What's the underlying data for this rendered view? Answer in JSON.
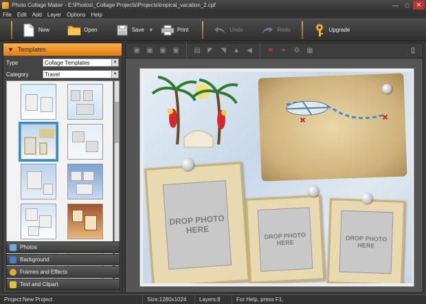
{
  "window": {
    "title": "Photo Collage Maker - E:\\Photos\\_Collage Projects\\Projects\\tropical_vacation_2.cpf"
  },
  "menu": [
    "File",
    "Edit",
    "Add",
    "Layer",
    "Options",
    "Help"
  ],
  "toolbar": {
    "new_label": "New",
    "open_label": "Open",
    "save_label": "Save",
    "print_label": "Print",
    "undo_label": "Undo",
    "redo_label": "Redo",
    "upgrade_label": "Upgrade"
  },
  "left_panel": {
    "header": "Templates",
    "type_label": "Type",
    "type_value": "Collage Templates",
    "category_label": "Category",
    "category_value": "Travel"
  },
  "accordion": [
    "Photos",
    "Background",
    "Frames and Effects",
    "Text and Clipart"
  ],
  "canvas": {
    "slot_text_1": "DROP PHOTO\nHERE",
    "slot_text_2": "DROP PHOTO\nHERE",
    "slot_text_3": "DROP PHOTO\nHERE"
  },
  "status": {
    "project": "Project:New Project",
    "size": "Size:1280x1024",
    "layers": "Layers:8",
    "help": "For Help, press F1."
  },
  "colors": {
    "accent": "#f08a1c",
    "selection": "#2e8fd9"
  }
}
